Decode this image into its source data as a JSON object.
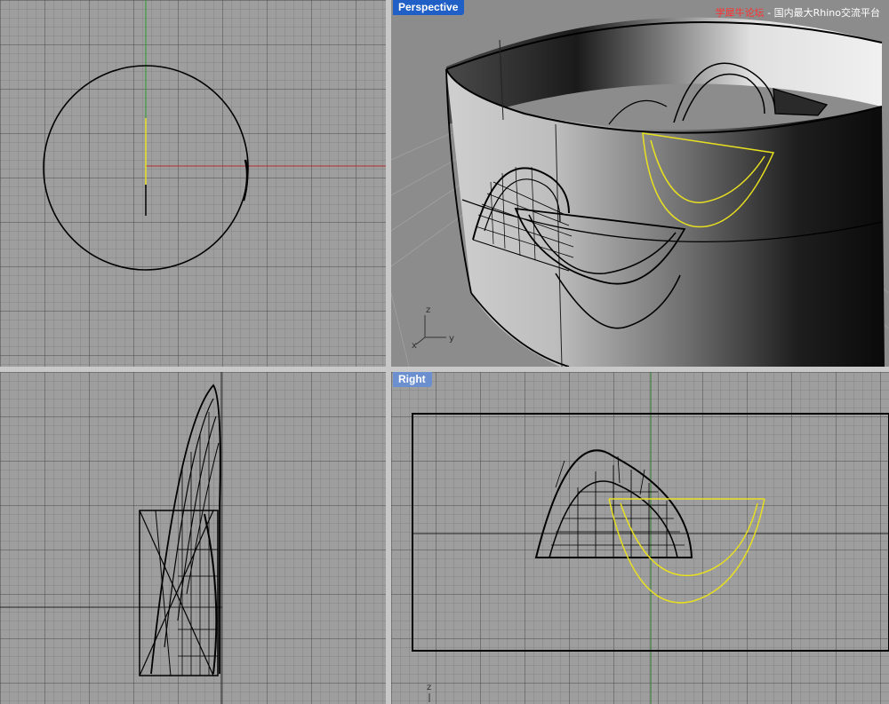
{
  "viewports": {
    "top": {
      "label": ""
    },
    "perspective": {
      "label": "Perspective"
    },
    "front": {
      "label": ""
    },
    "right": {
      "label": "Right"
    }
  },
  "watermark": {
    "brand": "学犀牛论坛",
    "separator": " - ",
    "tagline": "国内最大Rhino交流平台"
  },
  "axis_labels": {
    "x": "x",
    "y": "y",
    "z": "z"
  },
  "colors": {
    "viewport_bg": "#9e9e9e",
    "label_active": "#1f5fc6",
    "label_inactive": "#6b8fcf",
    "axis_x": "#b03030",
    "axis_y": "#30a030",
    "selected": "#e8e020",
    "curve": "#000000"
  }
}
